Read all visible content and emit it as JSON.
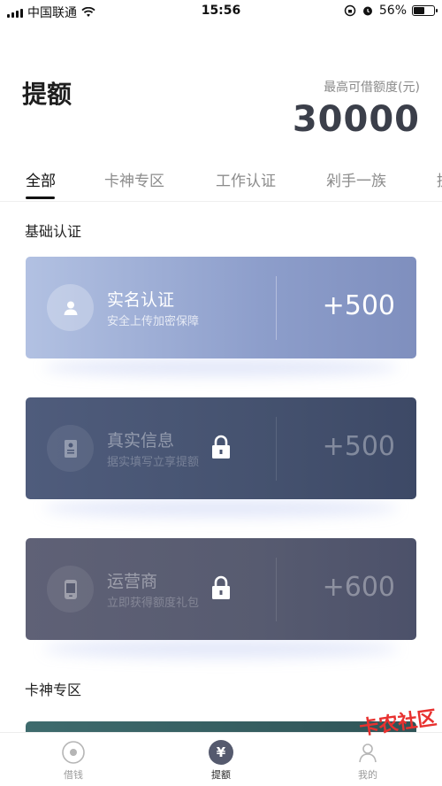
{
  "status_bar": {
    "carrier": "中国联通",
    "time": "15:56",
    "battery": "56%"
  },
  "header": {
    "title": "提额",
    "limit_label": "最高可借额度(元)",
    "limit_value": "30000"
  },
  "tabs": [
    {
      "label": "全部",
      "active": true
    },
    {
      "label": "卡神专区",
      "active": false
    },
    {
      "label": "工作认证",
      "active": false
    },
    {
      "label": "剁手一族",
      "active": false
    },
    {
      "label": "提",
      "active": false
    }
  ],
  "sections": {
    "basic": "基础认证",
    "card_god": "卡神专区"
  },
  "cards": [
    {
      "name": "实名认证",
      "desc": "安全上传加密保障",
      "bonus": "+500",
      "locked": false,
      "icon": "user-icon"
    },
    {
      "name": "真实信息",
      "desc": "据实填写立享提额",
      "bonus": "+500",
      "locked": true,
      "icon": "id-card-icon"
    },
    {
      "name": "运营商",
      "desc": "立即获得额度礼包",
      "bonus": "+600",
      "locked": true,
      "icon": "phone-icon"
    }
  ],
  "bottom_nav": [
    {
      "label": "借钱",
      "icon": "loan-icon",
      "active": false
    },
    {
      "label": "提额",
      "icon": "yuan-icon",
      "active": true
    },
    {
      "label": "我的",
      "icon": "profile-icon",
      "active": false
    }
  ],
  "watermark": "卡农社区",
  "colors": {
    "active_card": "#8d9ecb",
    "locked_card_1": "#45526f",
    "locked_card_2": "#575b70",
    "teal_card": "#3e6b6d"
  }
}
